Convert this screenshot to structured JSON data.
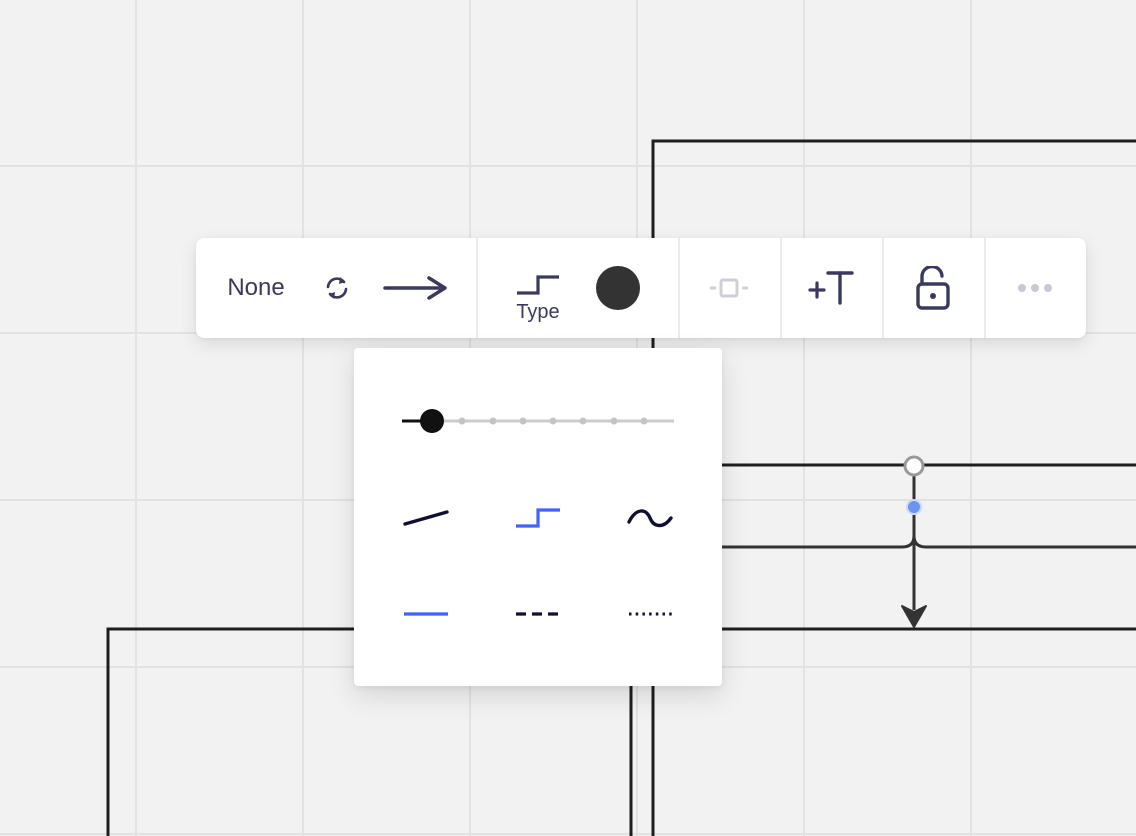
{
  "toolbar": {
    "start_cap_label": "None",
    "connector_type_label": "Type",
    "color": "#333333",
    "accent": "#4262ff",
    "icons": {
      "swap": "swap-arrows-icon",
      "end_cap": "arrow-right-icon",
      "connector_type": "elbow-connector-icon",
      "color": "color-swatch-icon",
      "waypoint": "waypoint-icon",
      "add_text": "add-text-icon",
      "lock": "unlock-icon",
      "more": "more-dots-icon"
    }
  },
  "panel": {
    "thickness": {
      "steps": 9,
      "selected_index": 1
    },
    "line_shapes": [
      "straight",
      "elbow",
      "curved"
    ],
    "selected_shape": "elbow",
    "line_styles": [
      "solid",
      "dashed",
      "dotted"
    ],
    "selected_style": "solid"
  }
}
